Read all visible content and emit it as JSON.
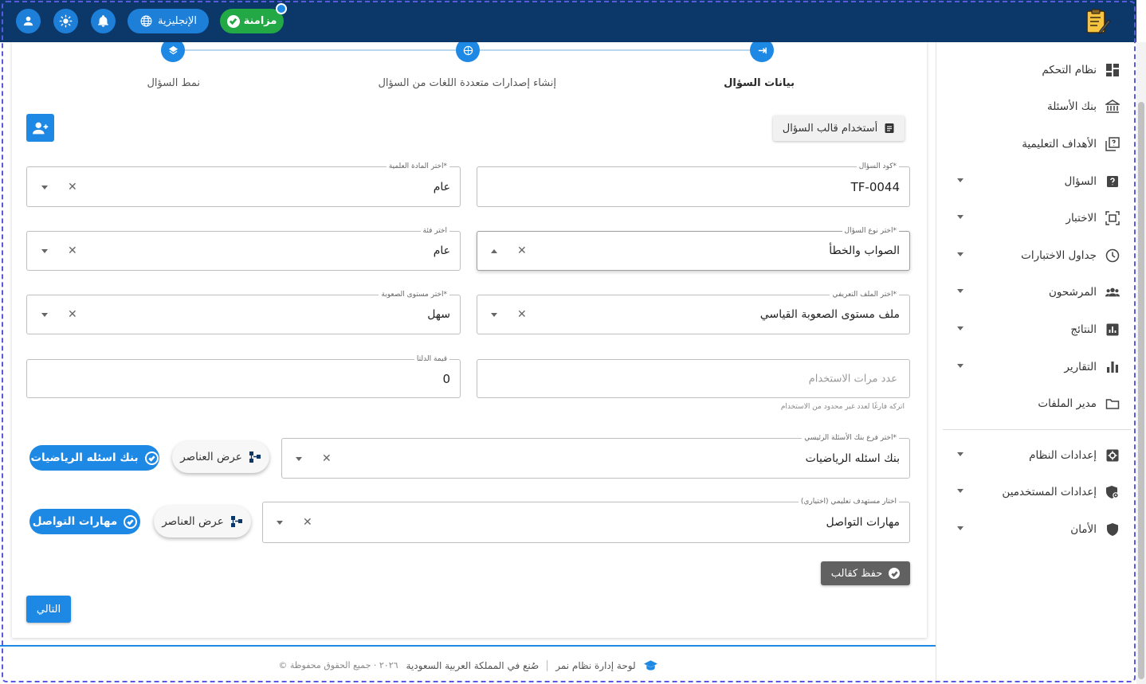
{
  "topbar": {
    "language_label": "الإنجليزية",
    "sync_label": "مزامنة",
    "icons": [
      "user-icon",
      "sun-icon",
      "bell-icon",
      "globe-icon",
      "check-circle-icon"
    ]
  },
  "stepper": {
    "steps": [
      {
        "label": "بيانات السؤال",
        "active": true,
        "icon": "arrow-right-icon"
      },
      {
        "label": "إنشاء إصدارات متعددة اللغات من السؤال",
        "active": false,
        "icon": "globe-icon"
      },
      {
        "label": "نمط السؤال",
        "active": false,
        "icon": "layers-icon"
      }
    ]
  },
  "toolbar": {
    "use_template_label": "أستخدام قالب السؤال"
  },
  "form": {
    "question_code": {
      "label": "كود السؤال*",
      "value": "TF-0044"
    },
    "subject": {
      "label": "اختر المادة العلمية*",
      "value": "عام"
    },
    "question_type": {
      "label": "اختر نوع السؤال*",
      "value": "الصواب والخطأ"
    },
    "category": {
      "label": "اختر فئة",
      "value": "عام"
    },
    "profile": {
      "label": "اختر الملف التعريفي*",
      "value": "ملف مستوى الصعوبة القياسي"
    },
    "difficulty": {
      "label": "اختر مستوى الصعوبة*",
      "value": "سهل"
    },
    "usage_count": {
      "placeholder": "عدد مرات الاستخدام",
      "hint": "اتركه فارغًا لعدد غير محدود من الاستخدام"
    },
    "delta": {
      "label": "قيمة الدلتا",
      "value": "0"
    },
    "bank_branch": {
      "label": "اختر فرع بنك الأسئلة الرئيسي*",
      "value": "بنك اسئله الرياضيات",
      "chip": "بنك اسئله الرياضيات",
      "show_items": "عرض العناصر"
    },
    "target": {
      "label": "اختار مستهدف تعليمي (اختياري)",
      "value": "مهارات التواصل",
      "chip": "مهارات التواصل",
      "show_items": "عرض العناصر"
    }
  },
  "actions": {
    "save_template": "حفظ كقالب",
    "next": "التالي"
  },
  "sidebar": {
    "items": [
      {
        "label": "نظام التحكم",
        "icon": "dashboard-icon",
        "caret": false
      },
      {
        "label": "بنك الأسئلة",
        "icon": "bank-icon",
        "caret": false
      },
      {
        "label": "الأهداف التعليمية",
        "icon": "objectives-icon",
        "caret": false
      },
      {
        "label": "السؤال",
        "icon": "question-icon",
        "caret": true
      },
      {
        "label": "الاختبار",
        "icon": "exam-icon",
        "caret": true
      },
      {
        "label": "جداول الاختبارات",
        "icon": "clock-icon",
        "caret": true
      },
      {
        "label": "المرشحون",
        "icon": "people-icon",
        "caret": true
      },
      {
        "label": "النتائج",
        "icon": "results-icon",
        "caret": true
      },
      {
        "label": "التقارير",
        "icon": "reports-icon",
        "caret": true
      },
      {
        "label": "مدير الملفات",
        "icon": "folder-icon",
        "caret": false
      },
      {
        "label": "إعدادات النظام",
        "icon": "settings-icon",
        "caret": true
      },
      {
        "label": "إعدادات المستخدمين",
        "icon": "user-settings-icon",
        "caret": true
      },
      {
        "label": "الأمان",
        "icon": "shield-icon",
        "caret": true
      }
    ]
  },
  "footer": {
    "brand": "لوحة إدارة نظام نمر",
    "made_in": "صُنع في المملكة العربية السعودية",
    "copyright": "© ٢٠٢٦ · جميع الحقوق محفوظة"
  },
  "colors": {
    "primary": "#1e88e5",
    "topbar": "#0c3769",
    "success": "#22a845",
    "dark_button": "#616161"
  }
}
